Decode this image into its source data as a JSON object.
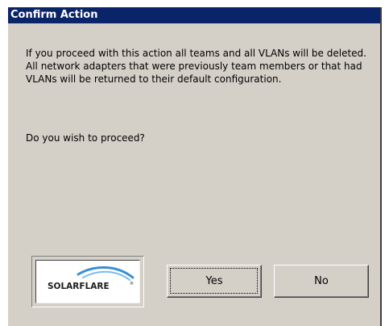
{
  "dialog": {
    "title": "Confirm Action",
    "message": "If you proceed with this action all teams and all VLANs will be deleted.  All network adapters that were previously team members or that had VLANs will be returned to their default configuration.",
    "question": "Do you wish to proceed?",
    "logo_text": "SOLARFLARE",
    "yes_label": "Yes",
    "no_label": "No"
  },
  "colors": {
    "titlebar": "#0a246a",
    "face": "#d4d0c8",
    "logo_arc": "#3a8fd6",
    "logo_text": "#1c1c1c"
  },
  "icons": {
    "logo": "solarflare-logo"
  }
}
